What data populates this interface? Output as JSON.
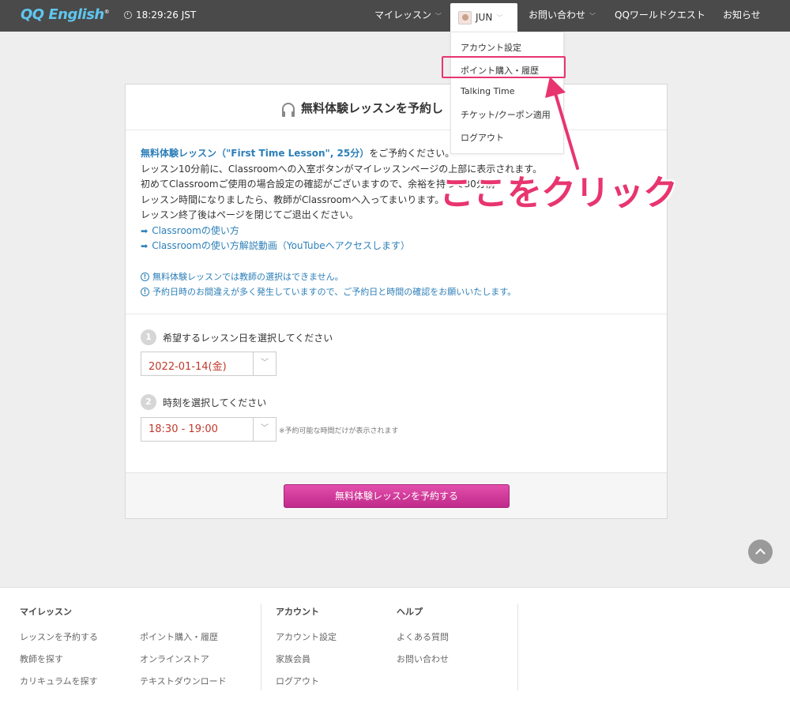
{
  "header": {
    "logo": "QQ English",
    "logo_mark": "®",
    "time": "18:29:26 JST",
    "nav": {
      "my_lessons": "マイレッスン",
      "user": "JUN",
      "contact": "お問い合わせ",
      "world_quest": "QQワールドクエスト",
      "news": "お知らせ"
    }
  },
  "user_menu": {
    "items": [
      "アカウント設定",
      "ポイント購入・履歴",
      "Talking Time",
      "チケット/クーポン適用",
      "ログアウト"
    ],
    "highlighted_index": 1
  },
  "annotation": {
    "text": "ここをクリック",
    "color": "#e8356f"
  },
  "card": {
    "title": "無料体験レッスンを予約し",
    "intro": {
      "lesson_name": "無料体験レッスン（\"First Time Lesson\", 25分）",
      "line1_suffix": "をご予約ください。",
      "line2": "レッスン10分前に、Classroomへの入室ボタンがマイレッスンページの上部に表示されます。",
      "line3": "初めてClassroomご使用の場合設定の確認がございますので、余裕を持って30分前",
      "line4": "レッスン時間になりましたら、教師がClassroomへ入ってまいります。",
      "line5": "レッスン終了後はページを閉じてご退出ください。"
    },
    "links": [
      "Classroomの使い方",
      "Classroomの使い方解説動画（YouTubeへアクセスします）"
    ],
    "notices": [
      "無料体験レッスンでは教師の選択はできません。",
      "予約日時のお間違えが多く発生していますので、ご予約日と時間の確認をお願いいたします。"
    ],
    "step1": {
      "num": "1",
      "label": "希望するレッスン日を選択してください",
      "value": "2022-01-14(金)"
    },
    "step2": {
      "num": "2",
      "label": "時刻を選択してください",
      "value": "18:30 - 19:00",
      "hint": "※予約可能な時間だけが表示されます"
    },
    "submit": "無料体験レッスンを予約する"
  },
  "footer": {
    "col1": {
      "title": "マイレッスン",
      "links": [
        "レッスンを予約する",
        "教師を探す",
        "カリキュラムを探す"
      ]
    },
    "col2": {
      "links": [
        "ポイント購入・履歴",
        "オンラインストア",
        "テキストダウンロード"
      ]
    },
    "col3": {
      "title": "アカウント",
      "links": [
        "アカウント設定",
        "家族会員",
        "ログアウト"
      ]
    },
    "col4": {
      "title": "ヘルプ",
      "links": [
        "よくある質問",
        "お問い合わせ"
      ]
    }
  }
}
